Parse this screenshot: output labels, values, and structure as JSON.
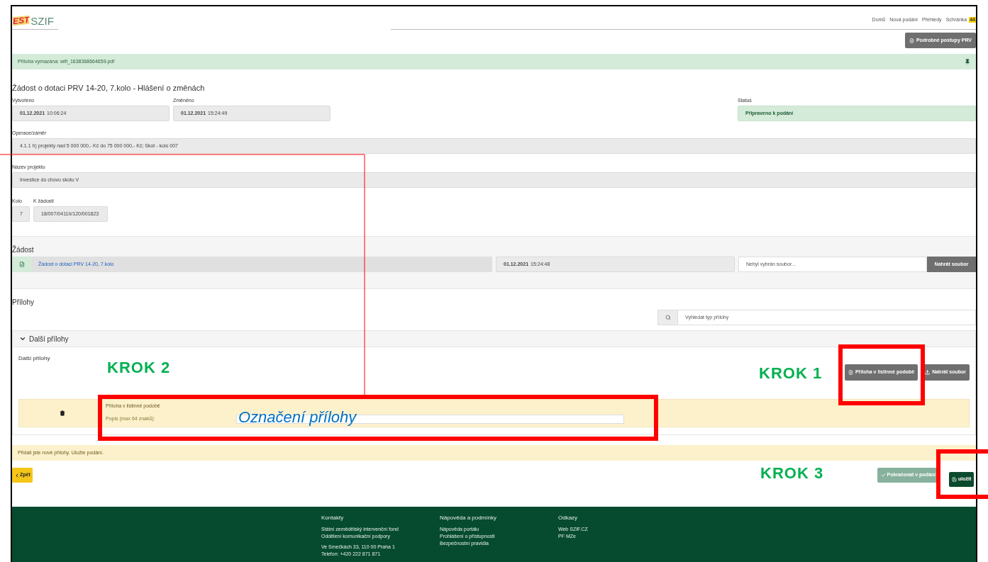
{
  "header": {
    "logo_mark": "EST",
    "logo_text": "SZIF",
    "nav": [
      {
        "label": "Domů"
      },
      {
        "label": "Nová podání"
      },
      {
        "label": "Přehledy"
      },
      {
        "label": "Schránka",
        "badge": "44"
      }
    ]
  },
  "guide_button": "Podrobné postupy PRV",
  "alert": {
    "text": "Příloha vymazána: wifi_1638368664659.pdf"
  },
  "title": "Žádost o dotaci PRV 14-20, 7.kolo - Hlášení o změnách",
  "created": {
    "label": "Vytvořeno",
    "date": "01.12.2021",
    "time": "10:06:24"
  },
  "changed": {
    "label": "Změněno",
    "date": "01.12.2021",
    "time": "15:24:49"
  },
  "status": {
    "label": "Status",
    "value": "Připraveno k podání"
  },
  "operation": {
    "label": "Operace/záměr",
    "value": "4.1.1 h) projekty nad 5 000 000,- Kč do 75 000 000,- Kč; Skot - kolo 007"
  },
  "project": {
    "label": "Název projektu",
    "value": "Investice do chovu skotu V"
  },
  "round": {
    "label": "Kolo",
    "value": "7"
  },
  "ref": {
    "label": "K žádosti",
    "value": "18/007/0411h/120/001823"
  },
  "application": {
    "heading": "Žádost",
    "link": "Žádost o dotaci PRV 14-20, 7.kolo",
    "date": "01.12.2021",
    "time": "15:24:48",
    "file_placeholder": "Nebyl vybrán soubor...",
    "upload": "Nahrát soubor"
  },
  "attachments": {
    "heading": "Přílohy",
    "search_placeholder": "Vyhledat typ přílohy",
    "group": {
      "title": "Další přílohy",
      "expanded": true,
      "label": "Další přílohy",
      "buttons": [
        "Příloha v listinné podobě",
        "Nahrát soubor"
      ],
      "items": [
        {
          "name": "Příloha v listinné podobě",
          "desc_label": "Popis (max 64 znaků):"
        }
      ]
    }
  },
  "notice": "Přidali jste nové přílohy. Uložte podání.",
  "actions": {
    "back": "Zpět",
    "continue": {
      "label": "Pokračovat v podání",
      "disabled": true
    },
    "save": "uložit"
  },
  "footer": [
    {
      "title": "Kontakty",
      "groups": [
        [
          "Státní zemědělský intervenční fond",
          "Oddělení komunikační podpory"
        ],
        [
          "Ve Smečkách 33, 110 00 Praha 1",
          "Telefon: +420 222 871 871"
        ]
      ]
    },
    {
      "title": "Nápověda a podmínky",
      "groups": [
        [
          "Nápověda portálu",
          "Prohlášení o přístupnosti",
          "Bezpečnostní pravidla"
        ]
      ]
    },
    {
      "title": "Odkazy",
      "groups": [
        [
          "Web SZIF.CZ",
          "PF MZe"
        ]
      ]
    }
  ],
  "annotations": [
    {
      "kind": "step",
      "text": "KROK 2"
    },
    {
      "kind": "step",
      "text": "KROK 1"
    },
    {
      "kind": "step",
      "text": "KROK 3"
    },
    {
      "kind": "callout",
      "text": "Označení přílohy"
    }
  ]
}
